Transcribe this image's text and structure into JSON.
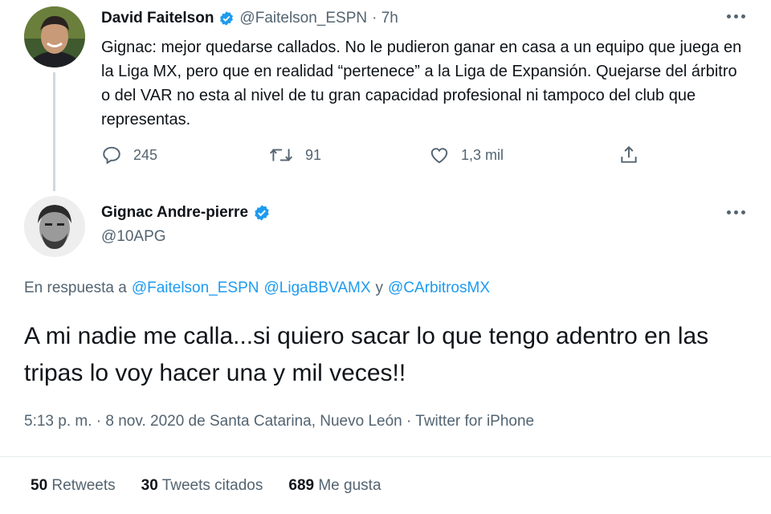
{
  "tweet1": {
    "name": "David Faitelson",
    "handle": "@Faitelson_ESPN",
    "time": "· 7h",
    "text": "Gignac: mejor quedarse callados. No le pudieron ganar en casa a un equipo que juega en la Liga MX, pero que en realidad “pertenece” a la Liga de Expansión. Quejarse del árbitro o del VAR no esta al nivel de tu gran capacidad profesional ni tampoco del club que representas.",
    "replies": "245",
    "retweets": "91",
    "likes": "1,3 mil"
  },
  "tweet2": {
    "name": "Gignac Andre-pierre",
    "handle": "@10APG",
    "reply_prefix": "En respuesta a",
    "reply_to_1": "@Faitelson_ESPN",
    "reply_to_2": "@LigaBBVAMX",
    "reply_conj": "y",
    "reply_to_3": "@CArbitrosMX",
    "text": "A mi nadie me calla...si quiero sacar lo que tengo adentro en las tripas lo voy hacer una y mil veces!!",
    "meta": "5:13 p. m. · 8 nov. 2020 de Santa Catarina, Nuevo León · Twitter for iPhone"
  },
  "stats": {
    "retweets_count": "50",
    "retweets_label": "Retweets",
    "quotes_count": "30",
    "quotes_label": "Tweets citados",
    "likes_count": "689",
    "likes_label": "Me gusta"
  },
  "colors": {
    "accent": "#1d9bf0",
    "muted": "#536471",
    "text": "#0f1419"
  },
  "icons": [
    "verified-badge-icon",
    "more-icon",
    "reply-icon",
    "retweet-icon",
    "like-icon",
    "share-icon"
  ]
}
